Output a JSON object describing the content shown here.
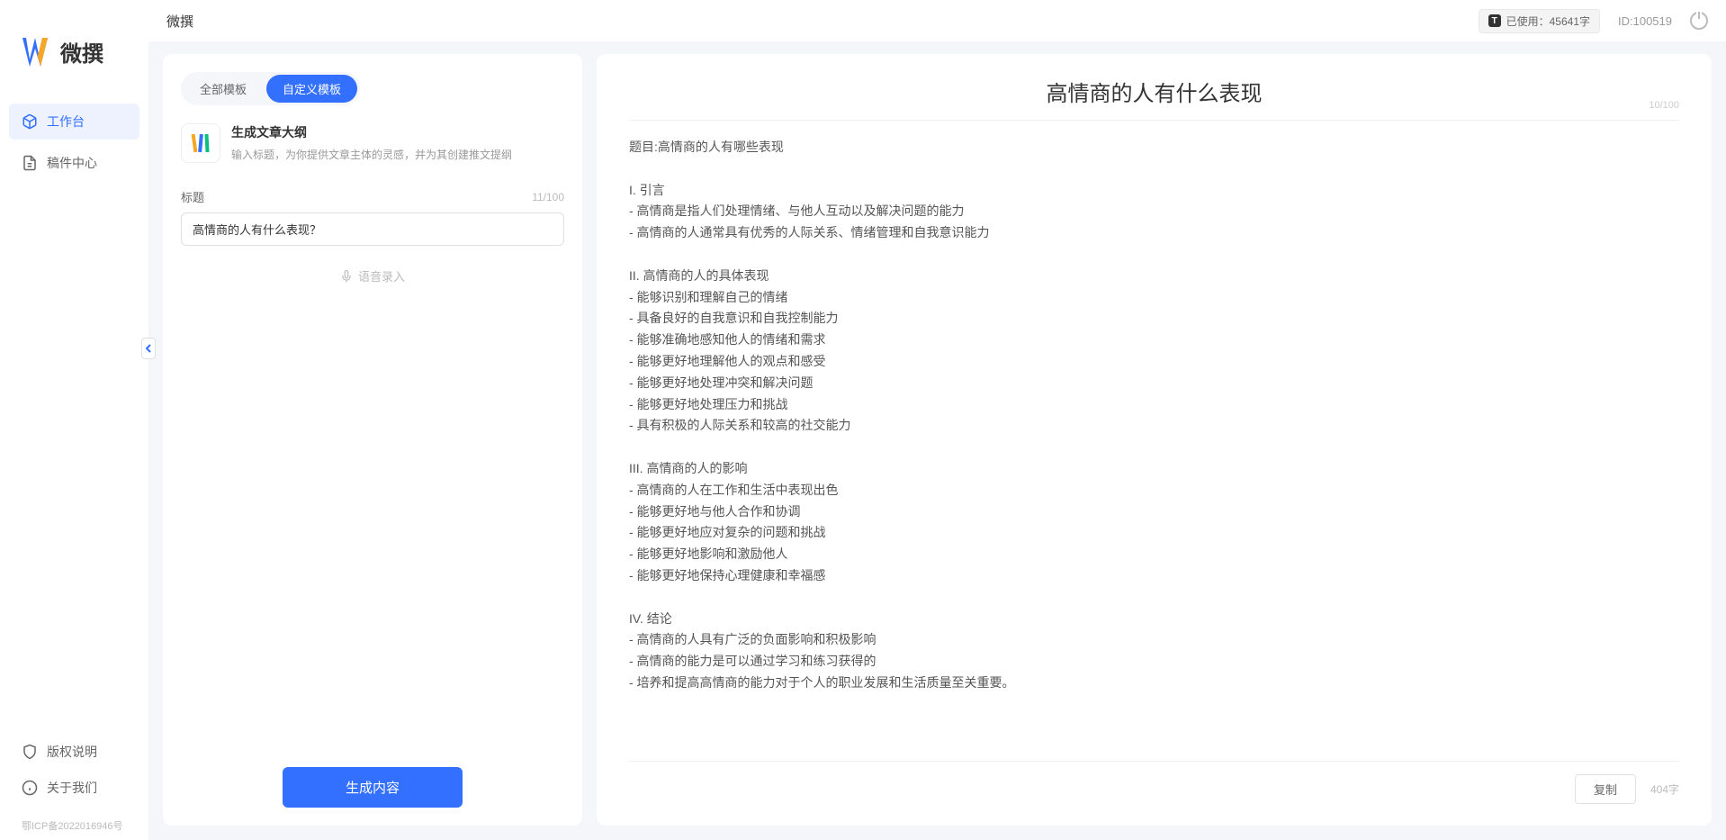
{
  "brand": {
    "name": "微撰"
  },
  "header": {
    "title": "微撰",
    "usage_label": "已使用：45641字",
    "user_id": "ID:100519"
  },
  "sidebar": {
    "items": [
      {
        "label": "工作台",
        "active": true
      },
      {
        "label": "稿件中心",
        "active": false
      }
    ],
    "footer_items": [
      {
        "label": "版权说明"
      },
      {
        "label": "关于我们"
      }
    ],
    "icp": "鄂ICP备2022016946号"
  },
  "left_panel": {
    "tabs": [
      {
        "label": "全部模板",
        "active": false
      },
      {
        "label": "自定义模板",
        "active": true
      }
    ],
    "template": {
      "title": "生成文章大纲",
      "desc": "输入标题，为你提供文章主体的灵感，并为其创建推文提纲"
    },
    "field": {
      "label": "标题",
      "counter": "11/100",
      "value": "高情商的人有什么表现？"
    },
    "voice_label": "语音录入",
    "generate_label": "生成内容"
  },
  "output": {
    "title": "高情商的人有什么表现",
    "top_counter": "10/100",
    "body": "题目:高情商的人有哪些表现\n\nI. 引言\n- 高情商是指人们处理情绪、与他人互动以及解决问题的能力\n- 高情商的人通常具有优秀的人际关系、情绪管理和自我意识能力\n\nII. 高情商的人的具体表现\n- 能够识别和理解自己的情绪\n- 具备良好的自我意识和自我控制能力\n- 能够准确地感知他人的情绪和需求\n- 能够更好地理解他人的观点和感受\n- 能够更好地处理冲突和解决问题\n- 能够更好地处理压力和挑战\n- 具有积极的人际关系和较高的社交能力\n\nIII. 高情商的人的影响\n- 高情商的人在工作和生活中表现出色\n- 能够更好地与他人合作和协调\n- 能够更好地应对复杂的问题和挑战\n- 能够更好地影响和激励他人\n- 能够更好地保持心理健康和幸福感\n\nIV. 结论\n- 高情商的人具有广泛的负面影响和积极影响\n- 高情商的能力是可以通过学习和练习获得的\n- 培养和提高高情商的能力对于个人的职业发展和生活质量至关重要。",
    "copy_label": "复制",
    "word_count": "404字"
  }
}
